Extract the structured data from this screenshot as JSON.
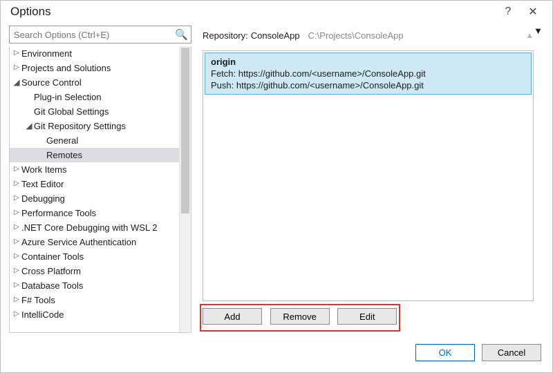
{
  "window": {
    "title": "Options",
    "help": "?",
    "close": "✕"
  },
  "search": {
    "placeholder": "Search Options (Ctrl+E)"
  },
  "tree": {
    "items": [
      {
        "label": "Environment",
        "depth": 0,
        "arrow": "right"
      },
      {
        "label": "Projects and Solutions",
        "depth": 0,
        "arrow": "right"
      },
      {
        "label": "Source Control",
        "depth": 0,
        "arrow": "down"
      },
      {
        "label": "Plug-in Selection",
        "depth": 1,
        "arrow": ""
      },
      {
        "label": "Git Global Settings",
        "depth": 1,
        "arrow": ""
      },
      {
        "label": "Git Repository Settings",
        "depth": 1,
        "arrow": "down"
      },
      {
        "label": "General",
        "depth": 2,
        "arrow": ""
      },
      {
        "label": "Remotes",
        "depth": 2,
        "arrow": "",
        "selected": true
      },
      {
        "label": "Work Items",
        "depth": 0,
        "arrow": "right"
      },
      {
        "label": "Text Editor",
        "depth": 0,
        "arrow": "right"
      },
      {
        "label": "Debugging",
        "depth": 0,
        "arrow": "right"
      },
      {
        "label": "Performance Tools",
        "depth": 0,
        "arrow": "right"
      },
      {
        "label": ".NET Core Debugging with WSL 2",
        "depth": 0,
        "arrow": "right"
      },
      {
        "label": "Azure Service Authentication",
        "depth": 0,
        "arrow": "right"
      },
      {
        "label": "Container Tools",
        "depth": 0,
        "arrow": "right"
      },
      {
        "label": "Cross Platform",
        "depth": 0,
        "arrow": "right"
      },
      {
        "label": "Database Tools",
        "depth": 0,
        "arrow": "right"
      },
      {
        "label": "F# Tools",
        "depth": 0,
        "arrow": "right"
      },
      {
        "label": "IntelliCode",
        "depth": 0,
        "arrow": "right"
      }
    ]
  },
  "repo": {
    "label": "Repository:",
    "name": "ConsoleApp",
    "path": "C:\\Projects\\ConsoleApp"
  },
  "remotes": [
    {
      "name": "origin",
      "fetch_label": "Fetch:",
      "fetch_url": "https://github.com/<username>/ConsoleApp.git",
      "push_label": "Push:",
      "push_url": "https://github.com/<username>/ConsoleApp.git"
    }
  ],
  "buttons": {
    "add": "Add",
    "remove": "Remove",
    "edit": "Edit"
  },
  "footer": {
    "ok": "OK",
    "cancel": "Cancel"
  }
}
